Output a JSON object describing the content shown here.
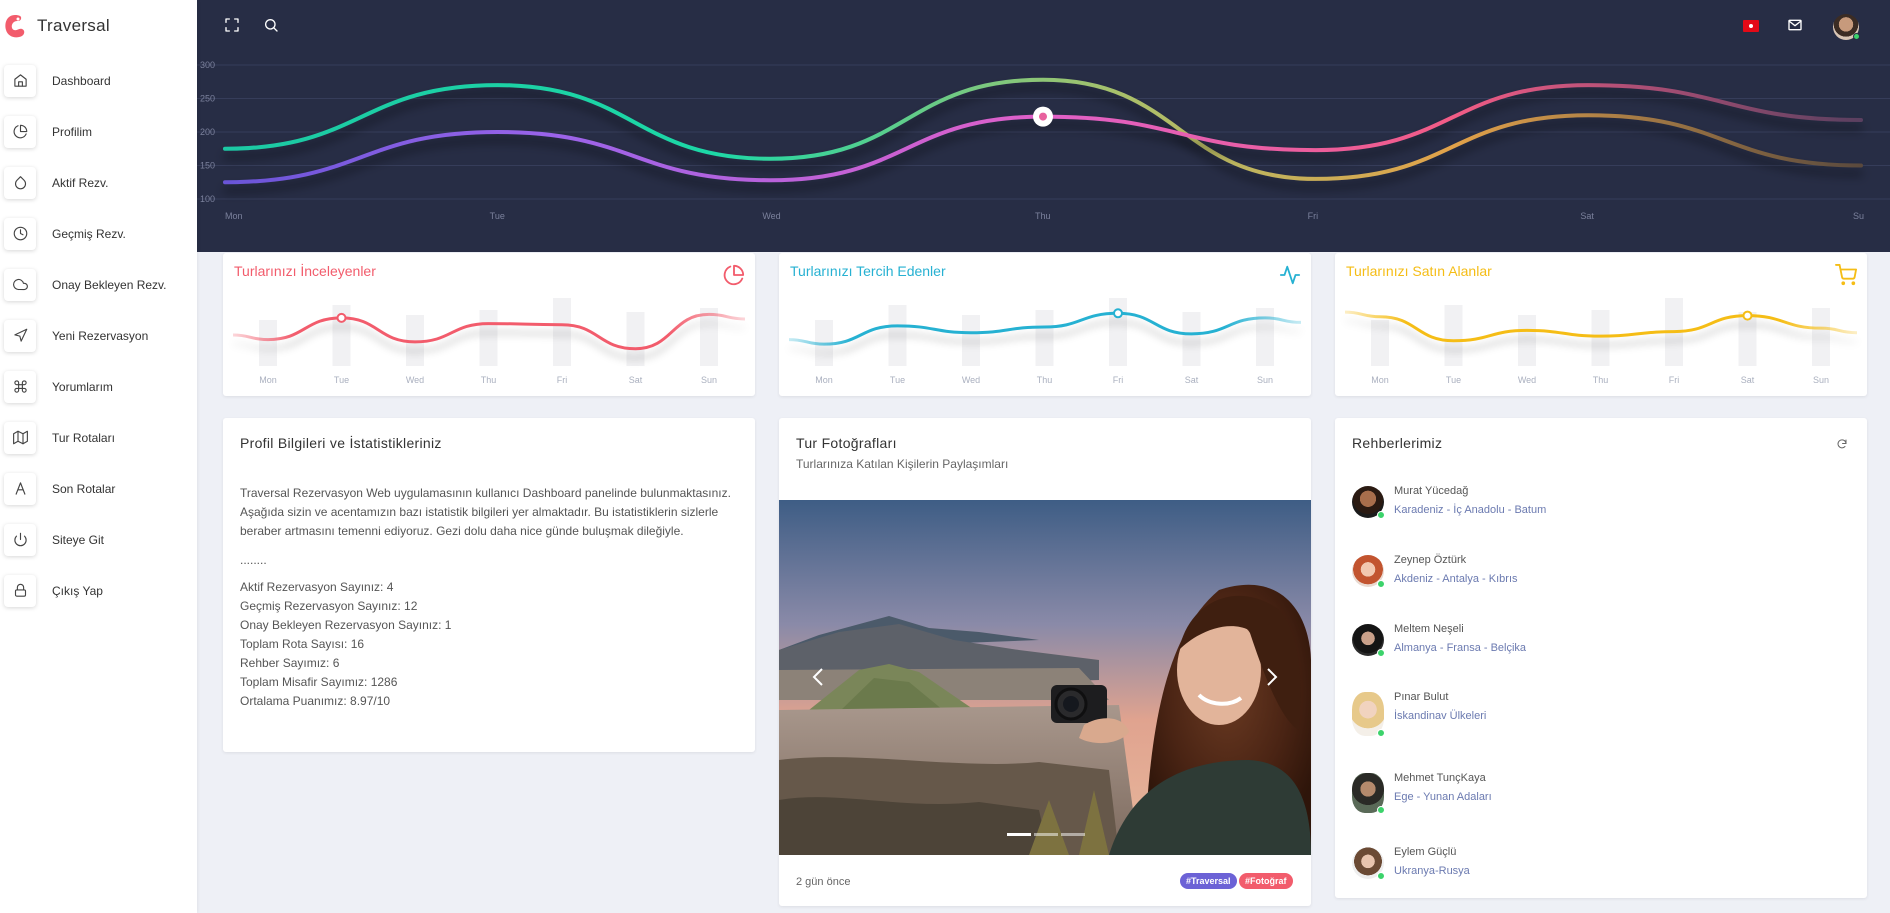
{
  "brand": {
    "name": "Traversal"
  },
  "sidebar": {
    "items": [
      {
        "label": "Dashboard",
        "icon": "home-icon"
      },
      {
        "label": "Profilim",
        "icon": "pie-chart-icon"
      },
      {
        "label": "Aktif Rezv.",
        "icon": "droplet-icon"
      },
      {
        "label": "Geçmiş Rezv.",
        "icon": "clock-icon"
      },
      {
        "label": "Onay Bekleyen Rezv.",
        "icon": "cloud-icon"
      },
      {
        "label": "Yeni Rezervasyon",
        "icon": "navigation-icon"
      },
      {
        "label": "Yorumlarım",
        "icon": "command-icon"
      },
      {
        "label": "Tur Rotaları",
        "icon": "map-icon"
      },
      {
        "label": "Son Rotalar",
        "icon": "text-a-icon"
      },
      {
        "label": "Siteye Git",
        "icon": "power-icon"
      },
      {
        "label": "Çıkış Yap",
        "icon": "lock-icon"
      }
    ]
  },
  "topbar": {
    "icons": [
      "fullscreen-icon",
      "search-icon",
      "turkey-flag-icon",
      "mail-icon",
      "user-avatar"
    ]
  },
  "chart_data": [
    {
      "type": "line",
      "categories": [
        "Mon",
        "Tue",
        "Wed",
        "Thu",
        "Fri",
        "Sat",
        "Su"
      ],
      "ylim": [
        100,
        300
      ],
      "yticks": [
        300,
        250,
        200,
        150,
        100
      ],
      "grid": true,
      "series": [
        {
          "values": [
            175,
            270,
            160,
            278,
            130,
            225,
            150
          ],
          "color": "#1dd8b0"
        },
        {
          "values": [
            125,
            200,
            128,
            223,
            173,
            270,
            218
          ],
          "color": "#e8619e"
        }
      ]
    },
    {
      "type": "line",
      "title": "Turlarınızı İnceleyenler",
      "categories": [
        "Mon",
        "Tue",
        "Wed",
        "Thu",
        "Fri",
        "Sat",
        "Sun"
      ],
      "values": [
        10,
        29,
        8,
        24,
        23,
        2,
        32
      ],
      "color": "#f25c6c"
    },
    {
      "type": "line",
      "title": "Turlarınızı Tercih Edenler",
      "categories": [
        "Mon",
        "Tue",
        "Wed",
        "Thu",
        "Fri",
        "Sat",
        "Sun"
      ],
      "values": [
        6,
        22,
        16,
        21,
        33,
        15,
        29
      ],
      "color": "#26b1d2"
    },
    {
      "type": "line",
      "title": "Turlarınızı Satın Alanlar",
      "categories": [
        "Mon",
        "Tue",
        "Wed",
        "Thu",
        "Fri",
        "Sat",
        "Sun"
      ],
      "values": [
        30,
        9,
        18,
        13,
        17,
        31,
        20
      ],
      "color": "#f5bd16"
    }
  ],
  "stats": [
    {
      "title": "Turlarınızı İnceleyenler",
      "color": "#f25c6c",
      "icon": "pie-chart-icon"
    },
    {
      "title": "Turlarınızı Tercih Edenler",
      "color": "#26b1d2",
      "icon": "activity-icon"
    },
    {
      "title": "Turlarınızı Satın Alanlar",
      "color": "#f5bd16",
      "icon": "shopping-cart-icon"
    }
  ],
  "profile": {
    "title": "Profil Bilgileri ve İstatistikleriniz",
    "intro": "Traversal Rezervasyon Web uygulamasının kullanıcı Dashboard panelinde bulunmaktasınız. Aşağıda sizin ve acentamızın bazı istatistik bilgileri yer almaktadır. Bu istatistiklerin sizlerle beraber artmasını temenni ediyoruz. Gezi dolu daha nice günde buluşmak dileğiyle.",
    "separator": "........",
    "lines": [
      "Aktif Rezervasyon Sayınız: 4",
      "Geçmiş Rezervasyon Sayınız: 12",
      "Onay Bekleyen Rezervasyon Sayınız: 1",
      "Toplam Rota Sayısı: 16",
      "Rehber Sayımız: 6",
      "Toplam Misafir Sayımız: 1286",
      "Ortalama Puanımız: 8.97/10"
    ]
  },
  "photos": {
    "title": "Tur Fotoğrafları",
    "subtitle": "Turlarınıza Katılan Kişilerin Paylaşımları",
    "time": "2 gün önce",
    "tags": [
      {
        "label": "#Traversal",
        "color": "#6c62d6"
      },
      {
        "label": "#Fotoğraf",
        "color": "#f25c6c"
      }
    ],
    "slide_count": 3,
    "active_slide": 1
  },
  "guides": {
    "title": "Rehberlerimiz",
    "items": [
      {
        "name": "Murat Yücedağ",
        "region": "Karadeniz - İç Anadolu - Batum"
      },
      {
        "name": "Zeynep Öztürk",
        "region": "Akdeniz - Antalya - Kıbrıs"
      },
      {
        "name": "Meltem Neşeli",
        "region": "Almanya - Fransa - Belçika"
      },
      {
        "name": "Pınar Bulut",
        "region": "İskandinav Ülkeleri"
      },
      {
        "name": "Mehmet TunçKaya",
        "region": "Ege - Yunan Adaları"
      },
      {
        "name": "Eylem Güçlü",
        "region": "Ukranya-Rusya"
      }
    ]
  }
}
